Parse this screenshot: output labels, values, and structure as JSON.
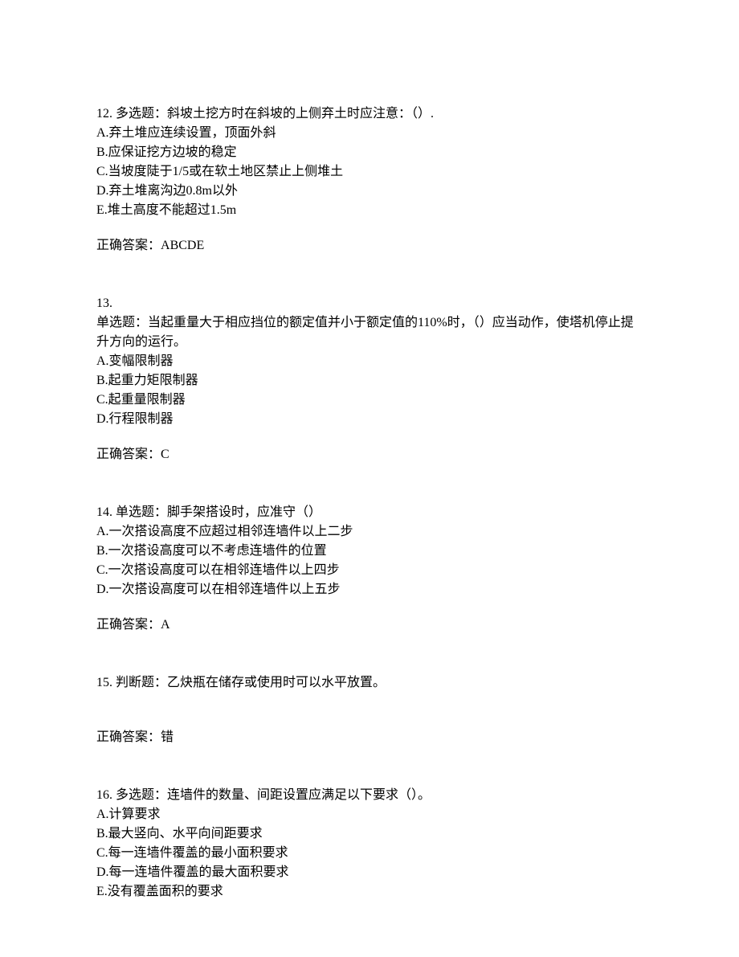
{
  "questions": [
    {
      "number": "12.",
      "type": "多选题：",
      "stem": "斜坡土挖方时在斜坡的上侧弃土时应注意：（）.",
      "options": [
        "A.弃土堆应连续设置，顶面外斜",
        "B.应保证挖方边坡的稳定",
        "C.当坡度陡于1/5或在软土地区禁止上侧堆土",
        "D.弃土堆离沟边0.8m以外",
        "E.堆土高度不能超过1.5m"
      ],
      "answer_label": "正确答案：",
      "answer": "ABCDE"
    },
    {
      "number": "13.",
      "type": "单选题：",
      "stem": "当起重量大于相应挡位的额定值并小于额定值的110%时，（）应当动作，使塔机停止提升方向的运行。",
      "options": [
        "A.变幅限制器",
        "B.起重力矩限制器",
        "C.起重量限制器",
        "D.行程限制器"
      ],
      "answer_label": "正确答案：",
      "answer": "C"
    },
    {
      "number": "14.",
      "type": "单选题：",
      "stem": "脚手架搭设时，应准守（）",
      "options": [
        "A.一次搭设高度不应超过相邻连墙件以上二步",
        "B.一次搭设高度可以不考虑连墙件的位置",
        "C.一次搭设高度可以在相邻连墙件以上四步",
        "D.一次搭设高度可以在相邻连墙件以上五步"
      ],
      "answer_label": "正确答案：",
      "answer": "A"
    },
    {
      "number": "15.",
      "type": "判断题：",
      "stem": "乙炔瓶在储存或使用时可以水平放置。",
      "options": [],
      "answer_label": "正确答案：",
      "answer": "错"
    },
    {
      "number": "16.",
      "type": "多选题：",
      "stem": "连墙件的数量、间距设置应满足以下要求（）。",
      "options": [
        "A.计算要求",
        "B.最大竖向、水平向间距要求",
        "C.每一连墙件覆盖的最小面积要求",
        "D.每一连墙件覆盖的最大面积要求",
        "E.没有覆盖面积的要求"
      ],
      "answer_label": "",
      "answer": ""
    }
  ]
}
